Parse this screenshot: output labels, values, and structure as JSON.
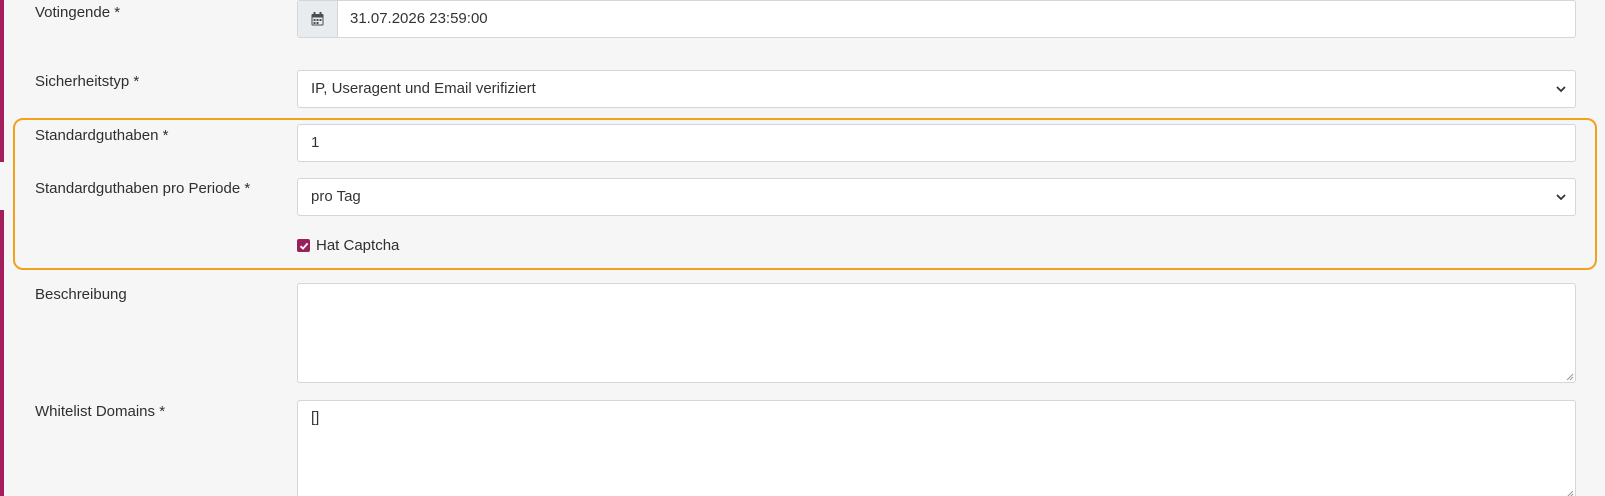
{
  "form": {
    "votingende": {
      "label": "Votingende *",
      "value": "31.07.2026 23:59:00",
      "icon": "calendar-icon"
    },
    "sicherheitstyp": {
      "label": "Sicherheitstyp *",
      "selected": "IP, Useragent und Email verifiziert"
    },
    "standardguthaben": {
      "label": "Standardguthaben *",
      "value": "1"
    },
    "standardguthaben_periode": {
      "label": "Standardguthaben pro Periode *",
      "selected": "pro Tag"
    },
    "captcha": {
      "label": "Hat Captcha",
      "checked": true
    },
    "beschreibung": {
      "label": "Beschreibung",
      "value": ""
    },
    "whitelist": {
      "label": "Whitelist Domains *",
      "value": "[]"
    }
  },
  "colors": {
    "accent": "#a41e5e",
    "highlight": "#f0a21f",
    "checkbox": "#9b1f5a"
  }
}
